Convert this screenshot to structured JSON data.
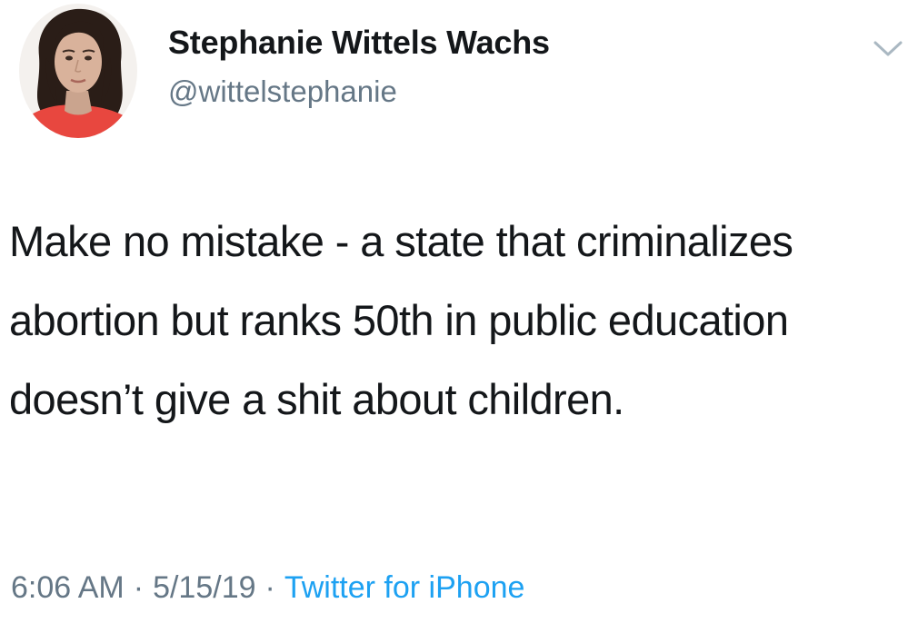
{
  "tweet": {
    "display_name": "Stephanie Wittels Wachs",
    "handle": "@wittelstephanie",
    "text": "Make no mistake - a state that criminalizes abortion but ranks 50th in public education doesn’t give a shit about children.",
    "time": "6:06 AM",
    "date": "5/15/19",
    "separator": "·",
    "source": "Twitter for iPhone"
  },
  "colors": {
    "text": "#14171a",
    "secondary": "#657786",
    "link": "#1da1f2",
    "avatar_shirt": "#e8473f"
  },
  "icons": {
    "menu": "chevron-down-icon",
    "avatar": "profile-photo"
  }
}
